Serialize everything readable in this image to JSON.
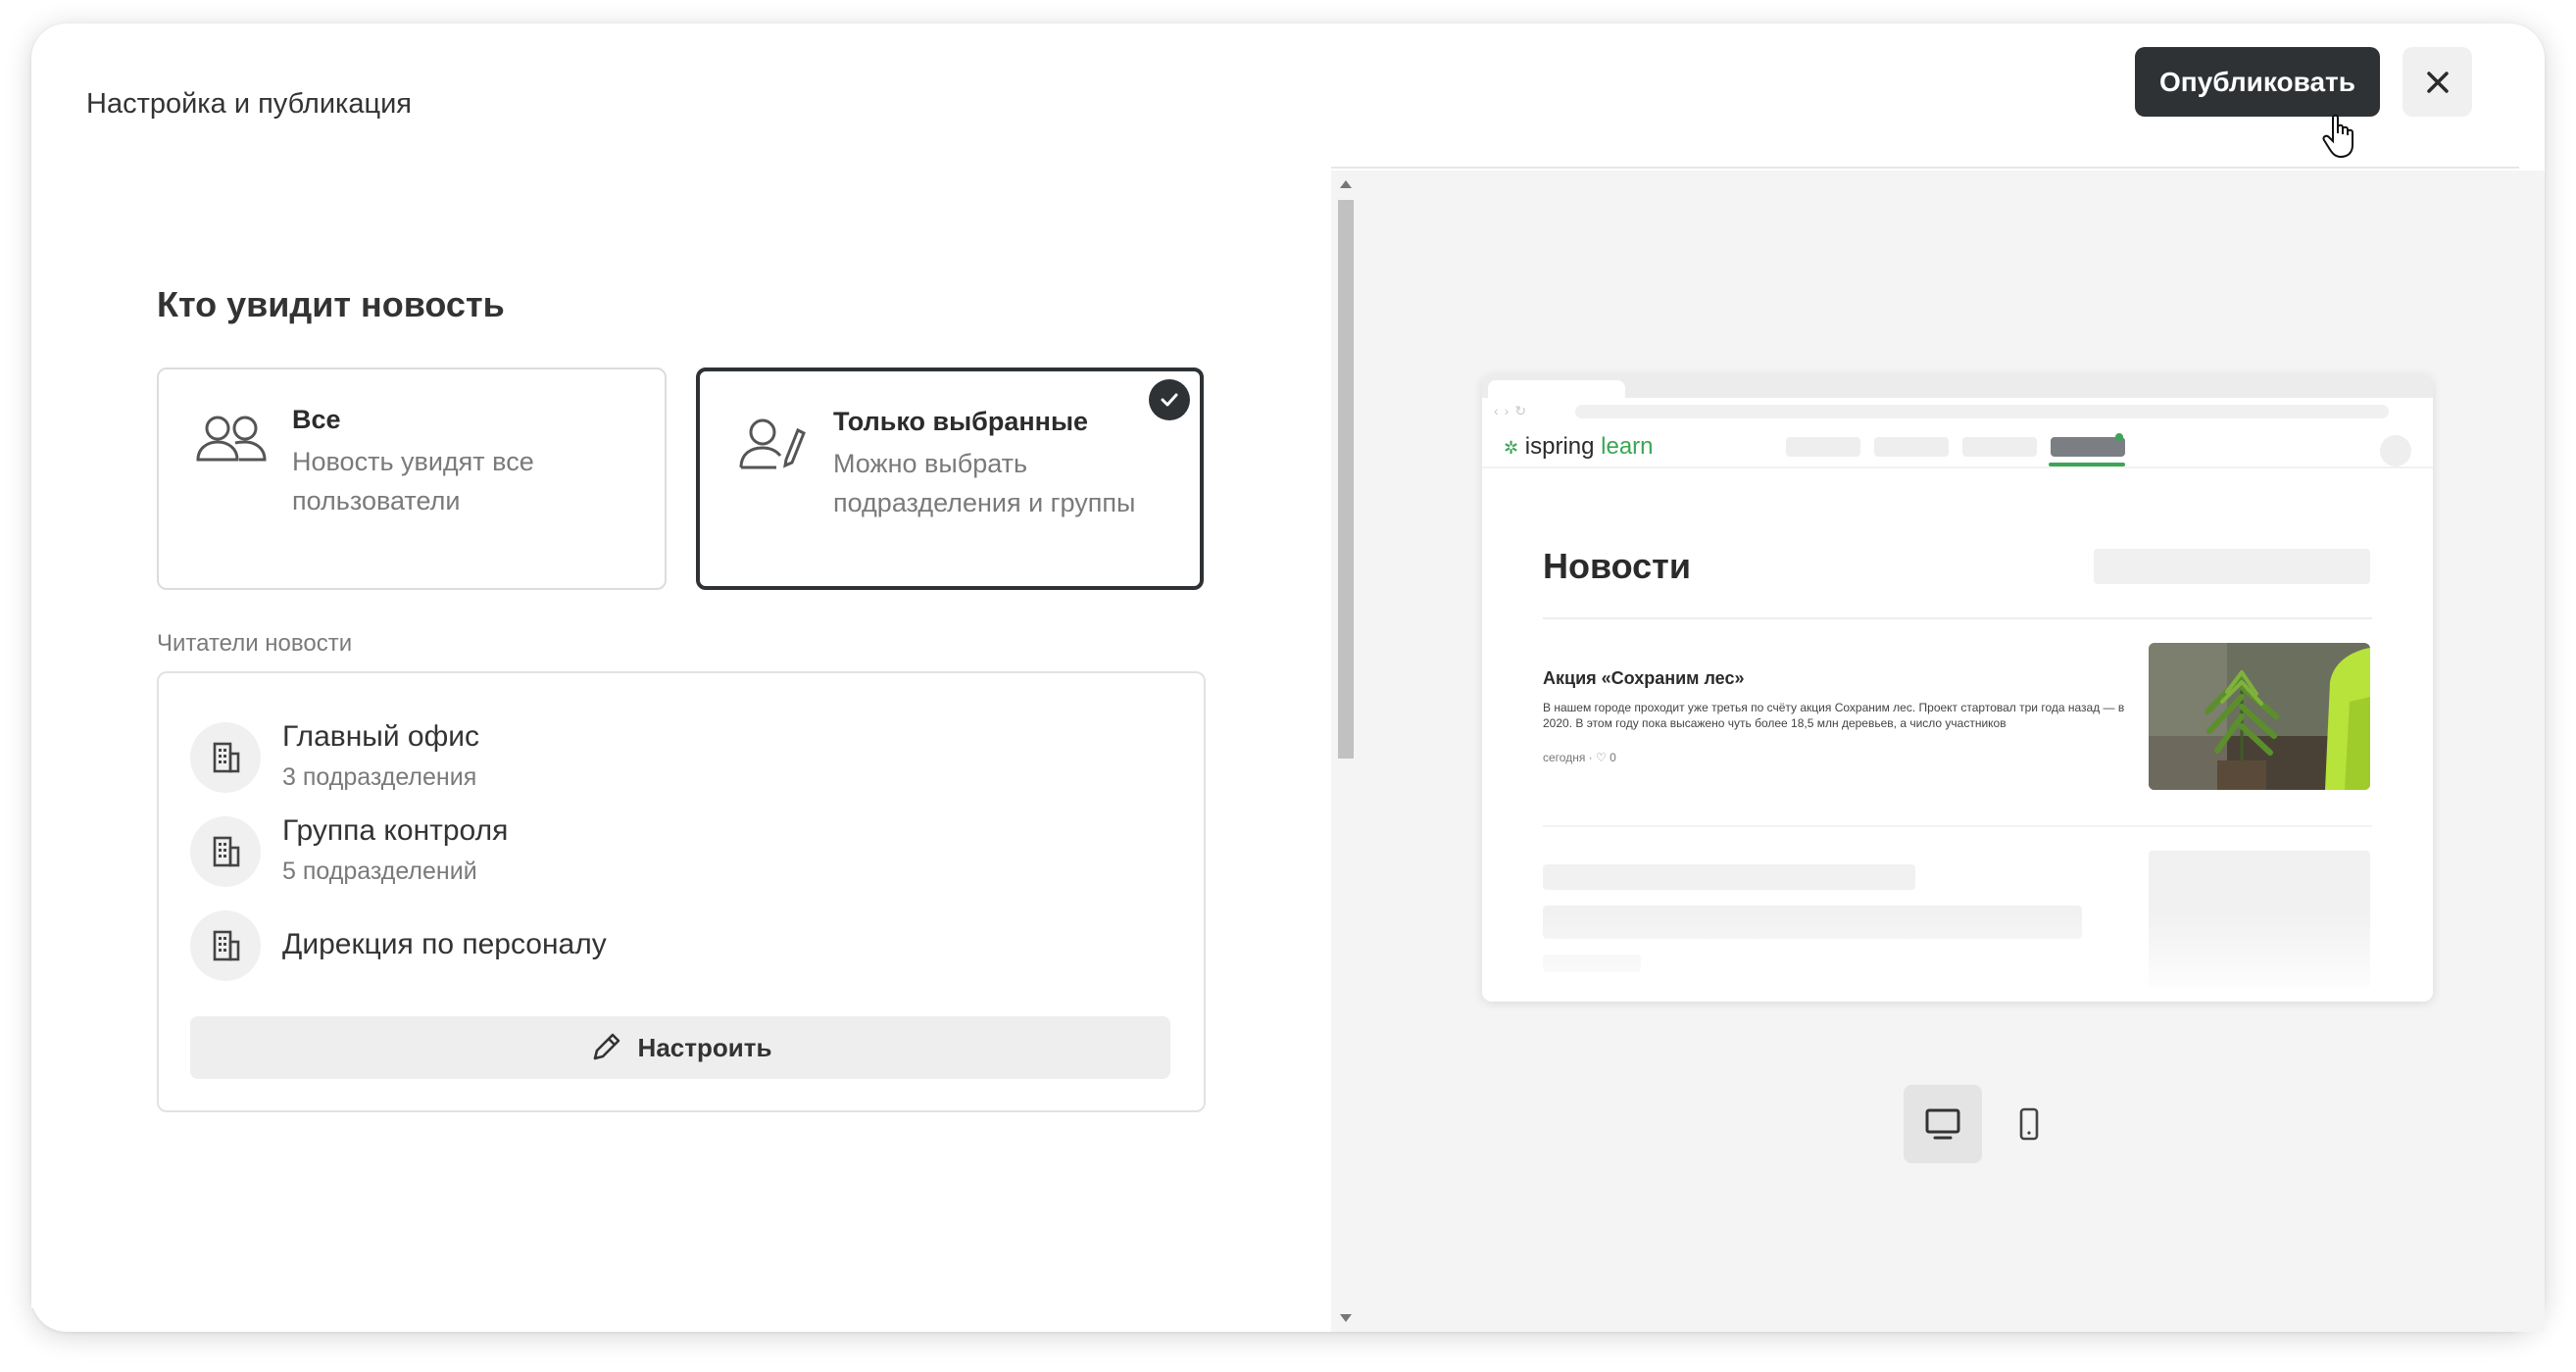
{
  "header": {
    "title": "Настройка и публикация",
    "publish_label": "Опубликовать"
  },
  "audience": {
    "title": "Кто увидит новость",
    "options": [
      {
        "title": "Все",
        "description": "Новость увидят все пользователи",
        "icon": "users-icon",
        "selected": false
      },
      {
        "title": "Только выбранные",
        "description": "Можно выбрать подразделения и группы",
        "icon": "user-edit-icon",
        "selected": true
      }
    ]
  },
  "readers": {
    "label": "Читатели новости",
    "items": [
      {
        "name": "Главный офис",
        "sub": "3 подразделения",
        "icon": "building-icon"
      },
      {
        "name": "Группа контроля",
        "sub": "5 подразделений",
        "icon": "building-icon"
      },
      {
        "name": "Дирекция по персоналу",
        "sub": "",
        "icon": "building-icon"
      }
    ],
    "configure_label": "Настроить"
  },
  "preview": {
    "logo_prefix": "ispring",
    "logo_suffix": "learn",
    "heading": "Новости",
    "article": {
      "title": "Акция «Сохраним лес»",
      "body": "В нашем городе проходит уже третья по счёту акция Сохраним лес. Проект стартовал три года назад — в 2020. В этом году пока высажено чуть более 18,5 млн деревьев, а число участников",
      "meta": "сегодня · ♡ 0"
    },
    "devices": [
      "desktop-icon",
      "mobile-icon"
    ],
    "active_device": "desktop"
  },
  "colors": {
    "primary_dark": "#2f3235",
    "brand_green": "#3aa655",
    "panel_bg": "#f4f4f4"
  }
}
